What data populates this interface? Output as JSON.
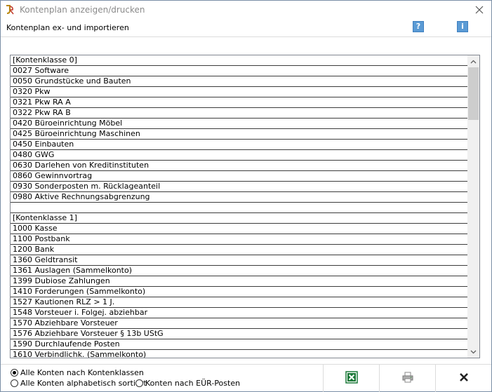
{
  "window": {
    "title": "Kontenplan anzeigen/drucken",
    "subtitle": "Kontenplan ex- und importieren",
    "help_label": "?",
    "info_label": "i"
  },
  "icons": {
    "app": "app-logo-icon",
    "close": "close-icon",
    "help": "help-icon",
    "info": "info-icon",
    "excel": "excel-export-icon",
    "print": "printer-icon",
    "cancel": "cancel-x-icon"
  },
  "colors": {
    "accent_blue": "#5b9bd5",
    "excel_green": "#1d7a3a",
    "row_border": "#3c3c3c"
  },
  "accounts": [
    "[Kontenklasse 0]",
    "0027 Software",
    "0050 Grundstücke und Bauten",
    "0320 Pkw",
    "0321 Pkw RA A",
    "0322 Pkw RA B",
    "0420 Büroeinrichtung Möbel",
    "0425 Büroeinrichtung Maschinen",
    "0450 Einbauten",
    "0480 GWG",
    "0630 Darlehen von Kreditinstituten",
    "0860 Gewinnvortrag",
    "0930 Sonderposten m. Rücklageanteil",
    "0980 Aktive Rechnungsabgrenzung",
    "",
    "[Kontenklasse 1]",
    "1000 Kasse",
    "1100 Postbank",
    "1200 Bank",
    "1360 Geldtransit",
    "1361 Auslagen (Sammelkonto)",
    "1399 Dubiose Zahlungen",
    "1410 Forderungen (Sammelkonto)",
    "1527 Kautionen RLZ > 1 J.",
    "1548 Vorsteuer i. Folgej. abziehbar",
    "1570 Abziehbare Vorsteuer",
    "1576 Abziehbare Vorsteuer § 13b UStG",
    "1590 Durchlaufende Posten",
    "1610 Verbindlichk. (Sammelkonto)"
  ],
  "options": {
    "by_class": "Alle Konten nach Kontenklassen",
    "alphabetical": "Alle Konten alphabetisch sortiert",
    "eur": "Konten nach EÜR-Posten",
    "selected": "by_class"
  }
}
